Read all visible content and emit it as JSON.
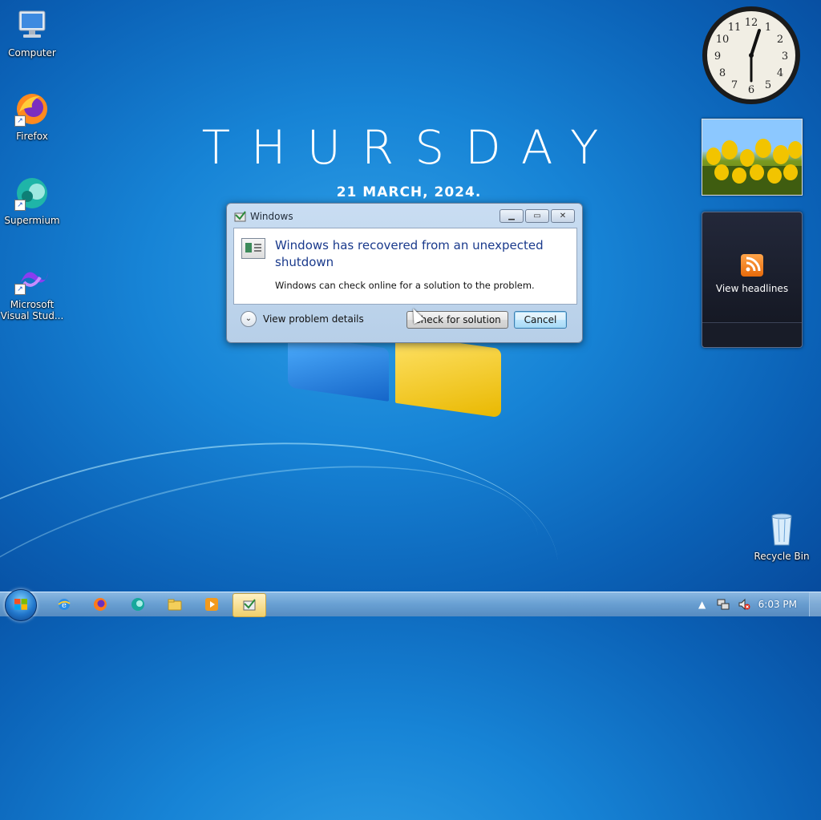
{
  "desktop": {
    "icons": [
      {
        "label": "Computer",
        "icon": "computer-icon"
      },
      {
        "label": "Firefox",
        "icon": "firefox-icon"
      },
      {
        "label": "Supermium",
        "icon": "supermium-icon"
      },
      {
        "label": "Microsoft\nVisual Stud...",
        "icon": "visual-studio-icon"
      },
      {
        "label": "Recycle Bin",
        "icon": "recycle-bin-icon"
      }
    ],
    "day": "THURSDAY",
    "date": "21 MARCH, 2024."
  },
  "gadgets": {
    "clock_numbers": [
      "12",
      "1",
      "2",
      "3",
      "4",
      "5",
      "6",
      "7",
      "8",
      "9",
      "10",
      "11"
    ],
    "feed_label": "View headlines"
  },
  "dialog": {
    "title": "Windows",
    "heading": "Windows has recovered from an unexpected shutdown",
    "message": "Windows can check online for a solution to the problem.",
    "details_label": "View problem details",
    "check_button": "Check for solution",
    "cancel_button": "Cancel"
  },
  "taskbar": {
    "items": [
      "internet-explorer-icon",
      "firefox-icon",
      "supermium-icon",
      "file-explorer-icon",
      "media-player-icon",
      "windows-error-reporting-icon"
    ],
    "clock": "6:03 PM"
  },
  "colors": {
    "accent": "#1a3a8c",
    "desktop_blue": "#1784d6"
  }
}
